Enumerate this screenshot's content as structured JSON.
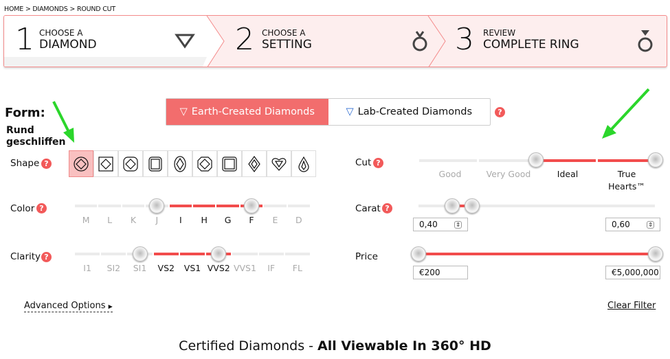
{
  "breadcrumb": "HOME > DIAMONDS > ROUND CUT",
  "steps": [
    {
      "num": "1",
      "small": "CHOOSE A",
      "big": "DIAMOND",
      "icon": "diamond-icon"
    },
    {
      "num": "2",
      "small": "CHOOSE A",
      "big": "SETTING",
      "icon": "ring-icon"
    },
    {
      "num": "3",
      "small": "REVIEW",
      "big": "COMPLETE RING",
      "icon": "ring-with-diamond-icon"
    }
  ],
  "toggle": {
    "earth": "Earth-Created Diamonds",
    "lab": "Lab-Created Diamonds",
    "selected": "earth"
  },
  "annotation": {
    "form": "Form:",
    "shape_note": "Rund geschliffen"
  },
  "filters": {
    "shape": {
      "label": "Shape",
      "options": [
        "round",
        "princess",
        "cushion",
        "emerald",
        "oval",
        "asscher",
        "radiant",
        "marquise",
        "heart",
        "pear"
      ],
      "selected": 0
    },
    "color": {
      "label": "Color",
      "ticks": [
        "M",
        "L",
        "K",
        "J",
        "I",
        "H",
        "G",
        "F",
        "E",
        "D"
      ],
      "range": [
        4,
        7
      ]
    },
    "clarity": {
      "label": "Clarity",
      "ticks": [
        "I1",
        "SI2",
        "SI1",
        "VS2",
        "VS1",
        "VVS2",
        "VVS1",
        "IF",
        "FL"
      ],
      "range": [
        3,
        5
      ]
    },
    "cut": {
      "label": "Cut",
      "ticks": [
        "Good",
        "Very Good",
        "Ideal",
        "True",
        "Hearts™"
      ],
      "range": [
        2,
        3
      ]
    },
    "carat": {
      "label": "Carat",
      "min": "0,40",
      "max": "0,60"
    },
    "price": {
      "label": "Price",
      "min": "€200",
      "max": "€5,000,000"
    }
  },
  "advanced": "Advanced Options",
  "clear": "Clear Filter",
  "footer": {
    "normal": "Certified Diamonds - ",
    "bold": "All Viewable In 360° HD"
  },
  "colors": {
    "accent": "#f26d6d",
    "annotation_arrow": "#2bd62b"
  }
}
